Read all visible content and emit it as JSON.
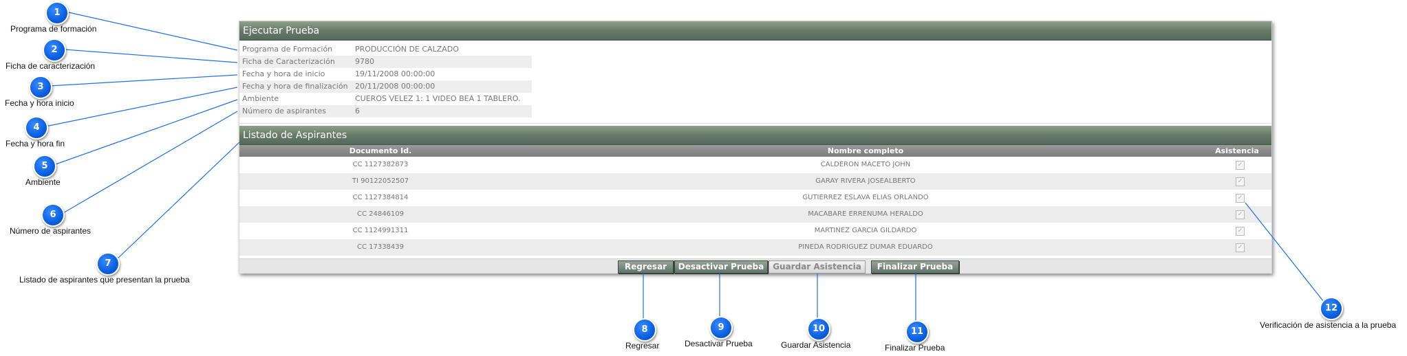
{
  "window": {
    "title": "Ejecutar Prueba"
  },
  "fields": [
    {
      "label": "Programa de Formación",
      "value": "PRODUCCIÓN DE CALZADO"
    },
    {
      "label": "Ficha de Caracterización",
      "value": "9780"
    },
    {
      "label": "Fecha y hora de inicio",
      "value": "19/11/2008 00:00:00"
    },
    {
      "label": "Fecha y hora de finalización",
      "value": "20/11/2008 00:00:00"
    },
    {
      "label": "Ambiente",
      "value": "CUEROS VELEZ 1: 1 VIDEO BEA 1 TABLERO."
    },
    {
      "label": "Número de aspirantes",
      "value": "6"
    }
  ],
  "list": {
    "title": "Listado de Aspirantes",
    "columns": [
      "Documento Id.",
      "Nombre completo",
      "Asistencia"
    ],
    "rows": [
      {
        "doc": "CC 1127382873",
        "name": "CALDERON MACETO JOHN",
        "checked": true
      },
      {
        "doc": "TI 90122052507",
        "name": "GARAY RIVERA JOSEALBERTO",
        "checked": true
      },
      {
        "doc": "CC 1127384814",
        "name": "GUTIERREZ ESLAVA ELIAS ORLANDO",
        "checked": true
      },
      {
        "doc": "CC 24846109",
        "name": "MACABARE ERRENUMA HERALDO",
        "checked": true
      },
      {
        "doc": "CC 1124991311",
        "name": "MARTINEZ GARCIA GILDARDO",
        "checked": true
      },
      {
        "doc": "CC 17338439",
        "name": "PINEDA RODRIGUEZ DUMAR EDUARDO",
        "checked": true
      }
    ],
    "check_glyph": "✓"
  },
  "buttons": [
    {
      "label": "Regresar",
      "enabled": true
    },
    {
      "label": "Desactivar Prueba",
      "enabled": true
    },
    {
      "label": "Guardar Asistencia",
      "enabled": false
    },
    {
      "label": "Finalizar Prueba",
      "enabled": true
    }
  ],
  "callouts": [
    {
      "number": "1",
      "label": "Programa de formación"
    },
    {
      "number": "2",
      "label": "Ficha de caracterización"
    },
    {
      "number": "3",
      "label": "Fecha y hora inicio"
    },
    {
      "number": "4",
      "label": "Fecha y hora fin"
    },
    {
      "number": "5",
      "label": "Ambiente"
    },
    {
      "number": "6",
      "label": "Número de aspirantes"
    },
    {
      "number": "7",
      "label": "Listado de aspirantes que presentan la prueba"
    },
    {
      "number": "8",
      "label": "Regresar"
    },
    {
      "number": "9",
      "label": "Desactivar Prueba"
    },
    {
      "number": "10",
      "label": "Guardar Asistencia"
    },
    {
      "number": "11",
      "label": "Finalizar Prueba"
    },
    {
      "number": "12",
      "label": "Verificación de asistencia a la prueba"
    }
  ],
  "colors": {
    "callout_badge": "#0a5fe0",
    "leader_line": "#1c6fe8",
    "header_green": "#6a7e6b",
    "table_header_gray": "#7a7a7a"
  }
}
